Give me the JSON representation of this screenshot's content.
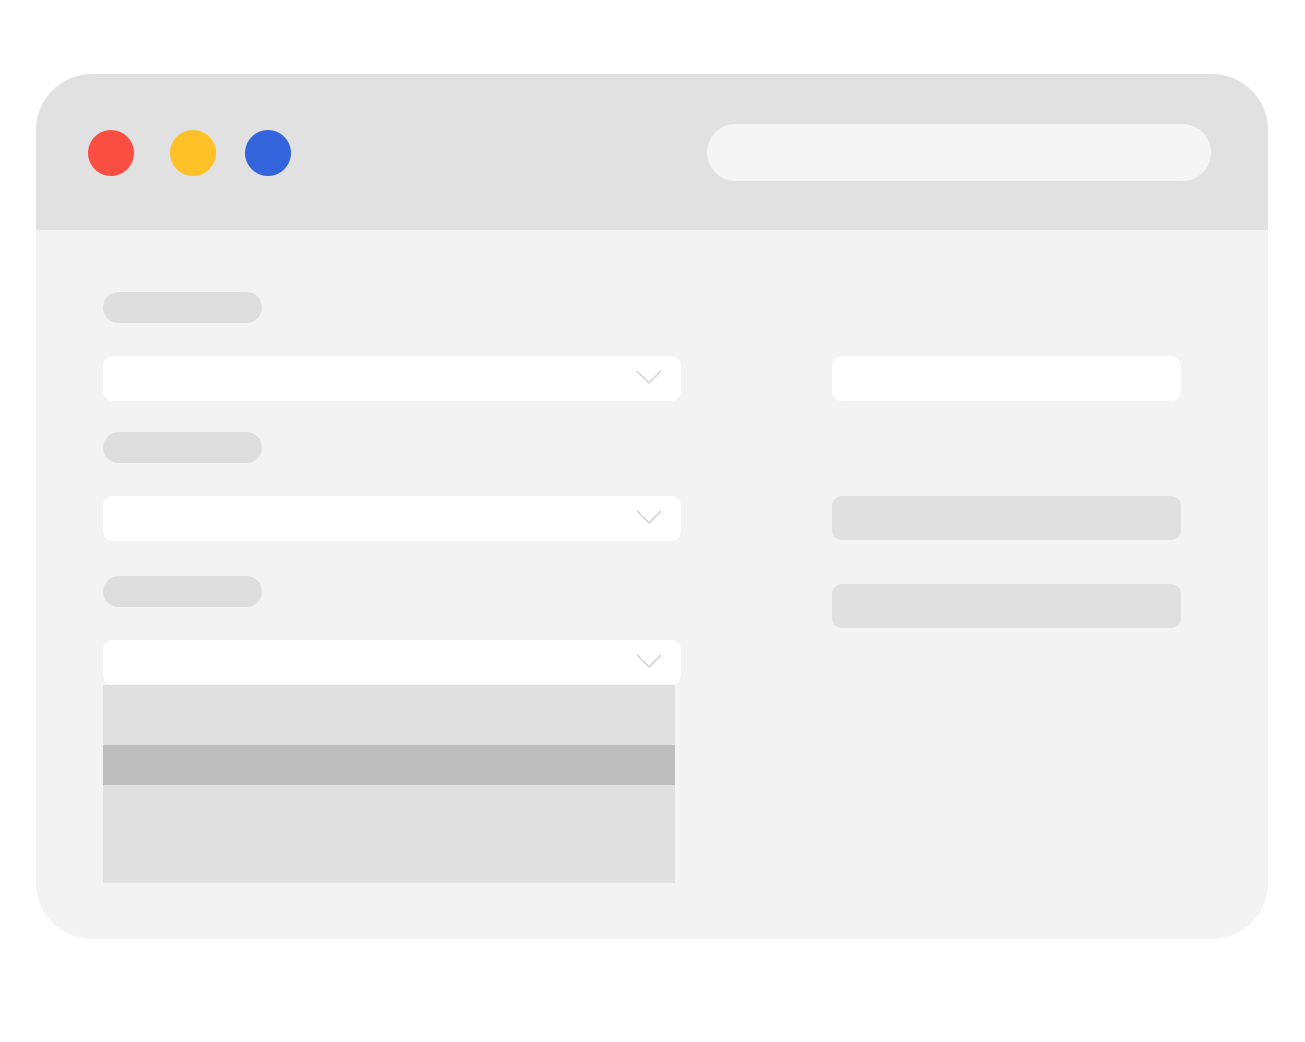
{
  "window": {
    "title": "",
    "traffic_lights": {
      "close_color": "#fb4e43",
      "minimize_color": "#fec128",
      "maximize_color": "#3364db"
    },
    "address_bar": {
      "value": "",
      "placeholder": ""
    }
  },
  "form": {
    "fields": [
      {
        "label": "",
        "select_value": "",
        "icon": "chevron-down-icon"
      },
      {
        "label": "",
        "select_value": "",
        "icon": "chevron-down-icon"
      },
      {
        "label": "",
        "select_value": "",
        "icon": "chevron-down-icon",
        "expanded": true
      }
    ],
    "dropdown_options": [
      {
        "label": "",
        "selected": false
      },
      {
        "label": "",
        "selected": true
      },
      {
        "label": "",
        "selected": false
      }
    ]
  },
  "side_panel": {
    "field_value": "",
    "bars": [
      {
        "label": ""
      },
      {
        "label": ""
      }
    ]
  },
  "colors": {
    "titlebar": "#e1e1e1",
    "content_background": "#f3f3f3",
    "placeholder_gray": "#dedede",
    "selected_option": "#bebebe"
  }
}
